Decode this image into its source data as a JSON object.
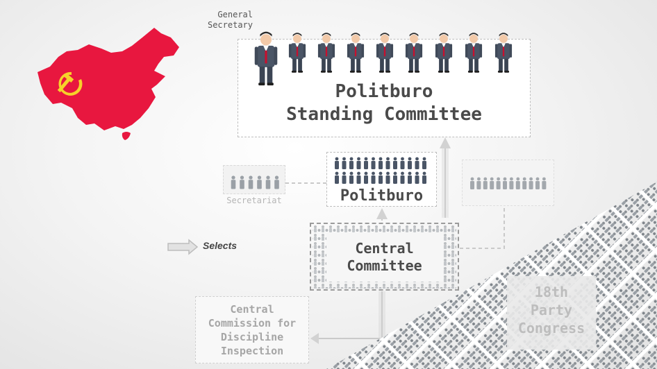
{
  "nodes": {
    "general_secretary": "General\nSecretary",
    "politburo_standing_committee": "Politburo\nStanding Committee",
    "politburo": "Politburo",
    "secretariat": "Secretariat",
    "central_committee": "Central\nCommittee",
    "ccdi": "Central\nCommission for\nDiscipline\nInspection",
    "party_congress": "18th\nParty\nCongress"
  },
  "legend": {
    "selects": "Selects"
  },
  "colors": {
    "map_red": "#e8173f",
    "emblem_yellow": "#f6d22a",
    "suit": "#4a5566",
    "tie": "#c8102e",
    "arrow": "#cfcfcf"
  },
  "icons": [
    "china-map-icon",
    "hammer-sickle-icon",
    "person-icon"
  ]
}
